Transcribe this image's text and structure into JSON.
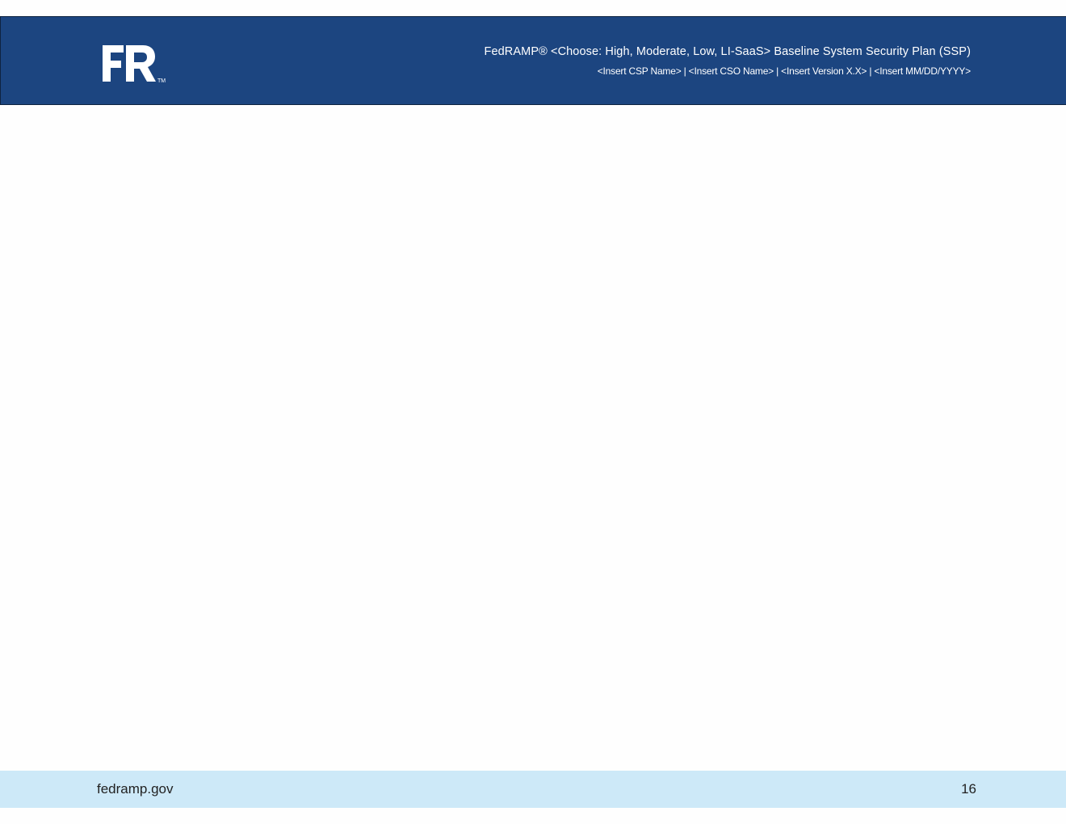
{
  "header": {
    "logo_text": "FR",
    "logo_mark": "TM",
    "title": "FedRAMP® <Choose: High, Moderate, Low, LI-SaaS> Baseline System Security Plan (SSP)",
    "subtitle": "<Insert CSP Name> | <Insert CSO Name> | <Insert Version X.X> | <Insert MM/DD/YYYY>"
  },
  "footer": {
    "site": "fedramp.gov",
    "page_number": "16"
  },
  "colors": {
    "header_background": "#1c4580",
    "footer_background": "#cde9f8",
    "header_text": "#ffffff"
  }
}
